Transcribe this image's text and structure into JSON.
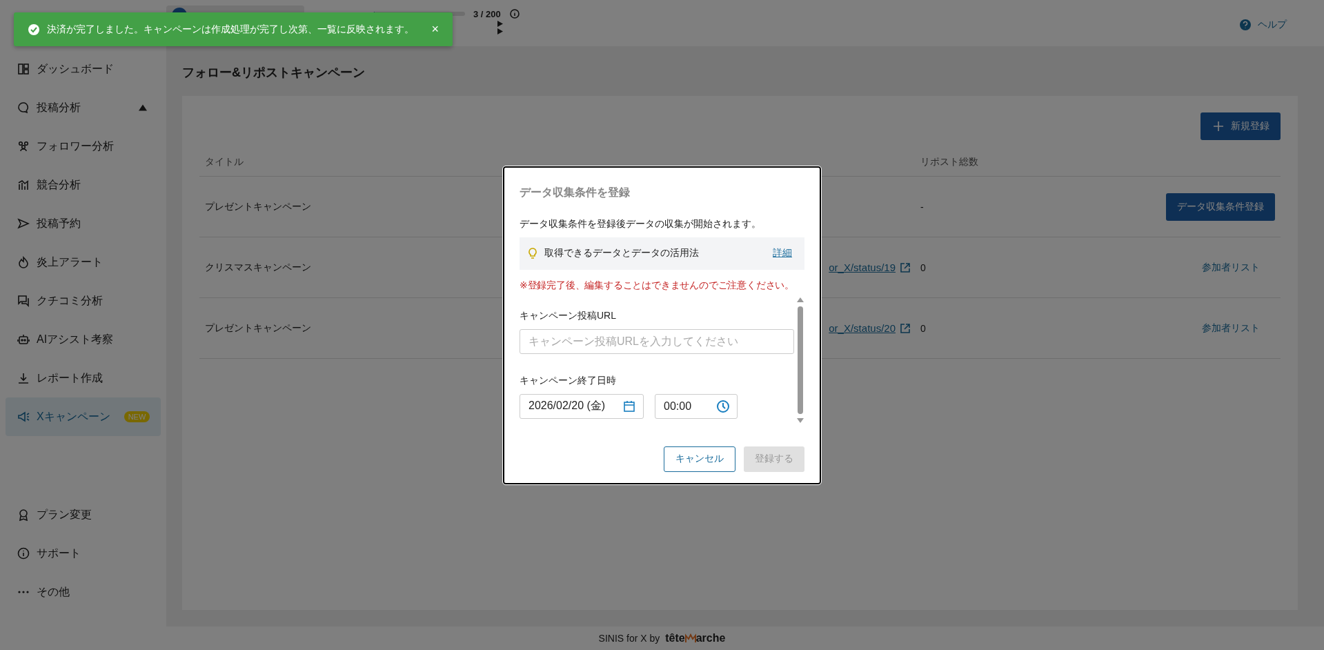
{
  "header": {
    "usage": {
      "level": 0.015,
      "reading": "3 / 200"
    },
    "help": "ヘルプ"
  },
  "toast": {
    "message": "決済が完了しました。キャンペーンは作成処理が完了し次第、一覧に反映されます。",
    "close": "×"
  },
  "sidebar": {
    "items": [
      {
        "label": "ダッシュボード",
        "selected": false
      },
      {
        "label": "投稿分析",
        "selected": false,
        "expanded": true
      },
      {
        "label": "フォロワー分析",
        "selected": false
      },
      {
        "label": "競合分析",
        "selected": false
      },
      {
        "label": "投稿予約",
        "selected": false
      },
      {
        "label": "炎上アラート",
        "selected": false
      },
      {
        "label": "クチコミ分析",
        "selected": false
      },
      {
        "label": "AIアシスト考察",
        "selected": false
      },
      {
        "label": "レポート作成",
        "selected": false
      },
      {
        "label": "Xキャンペーン",
        "selected": true,
        "badge": "NEW"
      }
    ],
    "bottom_items": [
      {
        "label": "プラン変更"
      },
      {
        "label": "サポート"
      },
      {
        "label": "その他"
      }
    ]
  },
  "page_title": "フォロー&リポストキャンペーン",
  "new_button": "新規登録",
  "table": {
    "column_1": "タイトル",
    "column_4": "リポスト総数",
    "rows": [
      {
        "title": "プレゼントキャンペーン",
        "reposts": "-",
        "action": {
          "kind": "button",
          "label": "データ収集条件登録"
        }
      },
      {
        "title": "クリスマスキャンペーン",
        "url": "or_X/status/19",
        "reposts": "0",
        "action": {
          "kind": "link",
          "label": "参加者リスト"
        }
      },
      {
        "title": "プレゼントキャンペーン",
        "url": "or_X/status/20",
        "reposts": "0",
        "action": {
          "kind": "link",
          "label": "参加者リスト"
        }
      }
    ]
  },
  "modal": {
    "title": "データ収集条件を登録",
    "description": "データ収集条件を登録後データの収集が開始されます。",
    "info": {
      "text": "取得できるデータとデータの活用法",
      "link": "詳細"
    },
    "warning": "※登録完了後、編集することはできませんのでご注意ください。",
    "url_label": "キャンペーン投稿URL",
    "url_placeholder": "キャンペーン投稿URLを入力してください",
    "end_label": "キャンペーン終了日時",
    "date": "2026/02/20 (金)",
    "time": "00:00",
    "cancel": "キャンセル",
    "submit": {
      "label": "登録する",
      "disabled": true
    }
  },
  "footer": {
    "text": "SINIS for X by",
    "brand_start": "tête",
    "brand_end": "arche"
  }
}
